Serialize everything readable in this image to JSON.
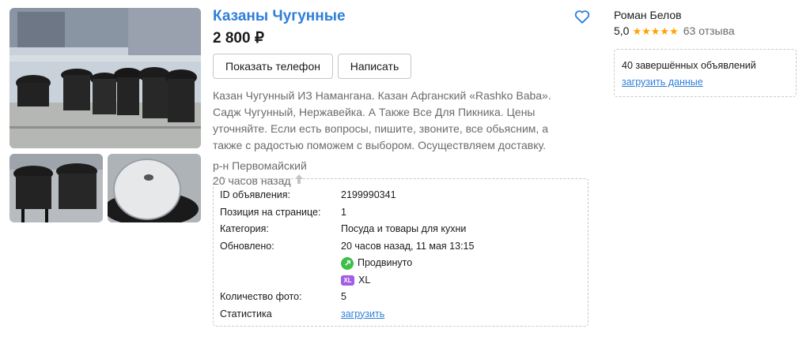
{
  "listing": {
    "title": "Казаны Чугунные",
    "price": "2 800 ₽",
    "show_phone_label": "Показать телефон",
    "write_label": "Написать",
    "description": "Казан Чугунный ИЗ Намангана. Казан Афганский «Rashko Baba». Садж Чугунный, Нержавейка. А Также Все Для Пикника. Цены уточняйте. Если есть вопросы, пишите, звоните, все обьясним, а также с радостью поможем с выбором. Осуществляем доставку.",
    "location": "р-н Первомайский",
    "time_ago": "20 часов назад"
  },
  "info": {
    "id_label": "ID объявления:",
    "id_value": "2199990341",
    "position_label": "Позиция на странице:",
    "position_value": "1",
    "category_label": "Категория:",
    "category_value": "Посуда и товары для кухни",
    "updated_label": "Обновлено:",
    "updated_value": "20 часов назад, 11 мая 13:15",
    "promoted_label": "Продвинуто",
    "xl_badge": "XL",
    "xl_label": "XL",
    "photo_count_label": "Количество фото:",
    "photo_count_value": "5",
    "stats_label": "Статистика",
    "stats_link": "загрузить"
  },
  "seller": {
    "name": "Роман Белов",
    "rating": "5,0",
    "stars": "★★★★★",
    "reviews": "63 отзыва",
    "completed": "40 завершённых объявлений",
    "load_link": "загрузить данные"
  },
  "colors": {
    "accent": "#2f7fd8",
    "stars": "#ffa200",
    "promoted": "#3fbf4a",
    "xl": "#a25ce6"
  },
  "icons": [
    "heart-icon",
    "arrow-up-icon",
    "promoted-icon",
    "xl-icon",
    "star-icon"
  ]
}
